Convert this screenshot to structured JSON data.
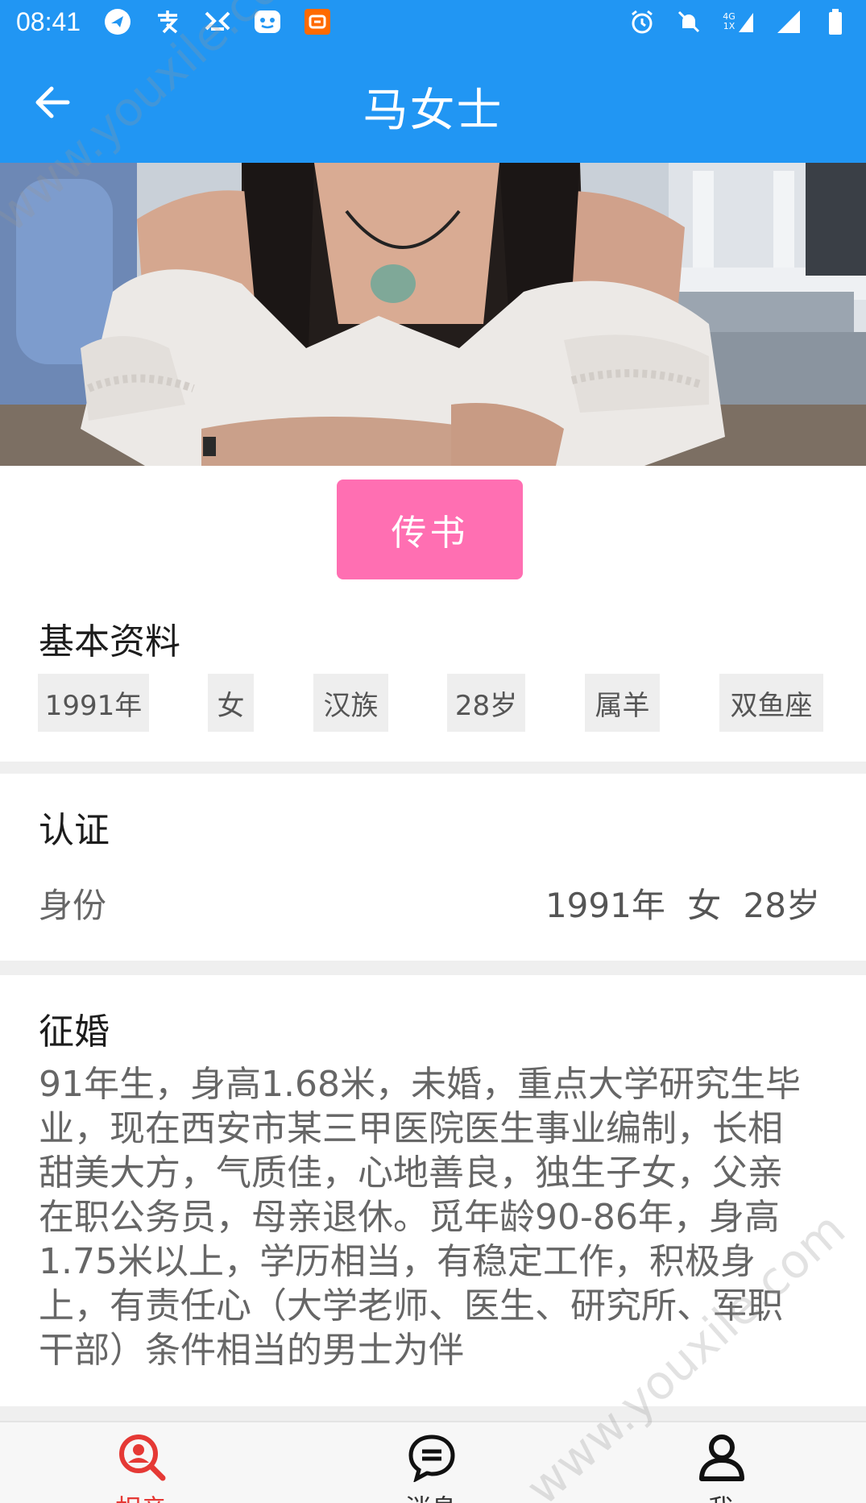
{
  "status_bar": {
    "time": "08:41",
    "left_icons": [
      "app-bird-icon",
      "alipay-icon",
      "xianyu-icon",
      "chat-app-icon",
      "taobao-icon"
    ],
    "right_icons": [
      "alarm-icon",
      "notifications-off-icon",
      "signal-4g-icon",
      "signal-icon",
      "battery-icon"
    ],
    "network_label_top": "4G",
    "network_label_bottom": "1X",
    "color": "#2196f3"
  },
  "app_bar": {
    "title": "马女士",
    "back_icon": "arrow-left-icon"
  },
  "actions": {
    "send_letter_label": "传书",
    "send_letter_color": "#ff6fb2"
  },
  "basic_info": {
    "title": "基本资料",
    "tags": [
      "1991年",
      "女",
      "汉族",
      "28岁",
      "属羊",
      "双鱼座"
    ]
  },
  "verification": {
    "title": "认证",
    "label": "身份",
    "value": "1991年 女 28岁"
  },
  "marriage": {
    "title": "征婚",
    "description": "91年生，身高1.68米，未婚，重点大学研究生毕业，现在西安市某三甲医院医生事业编制，长相甜美大方，气质佳，心地善良，独生子女，父亲在职公务员，母亲退休。觅年龄90-86年，身高1.75米以上，学历相当，有稳定工作，积极身上，有责任心（大学老师、医生、研究所、军职干部）条件相当的男士为伴"
  },
  "bottom_nav": {
    "items": [
      {
        "label": "相亲",
        "icon": "search-person-icon",
        "active": true
      },
      {
        "label": "消息",
        "icon": "chat-bubble-icon",
        "active": false
      },
      {
        "label": "我",
        "icon": "user-icon",
        "active": false
      }
    ],
    "active_color": "#e53935"
  },
  "watermark": "www.youxile.com"
}
